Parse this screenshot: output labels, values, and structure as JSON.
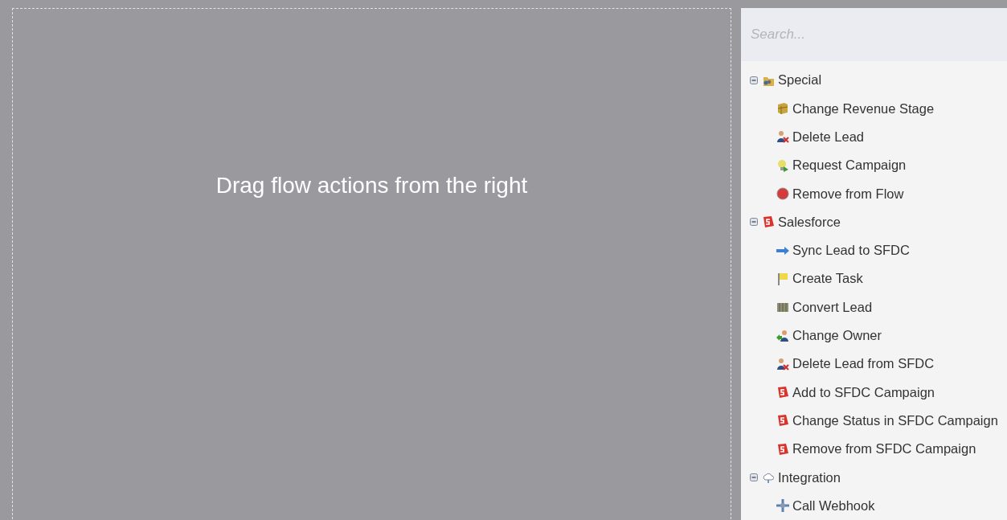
{
  "canvas": {
    "hint": "Drag flow actions from the right"
  },
  "search": {
    "placeholder": "Search..."
  },
  "tree": [
    {
      "label": "Special",
      "kind": "folder",
      "expanded": true,
      "children": [
        {
          "label": "Change Revenue Stage",
          "kind": "box"
        },
        {
          "label": "Delete Lead",
          "kind": "user-x"
        },
        {
          "label": "Request Campaign",
          "kind": "bulb"
        },
        {
          "label": "Remove from Flow",
          "kind": "stop"
        }
      ]
    },
    {
      "label": "Salesforce",
      "kind": "sfdc",
      "expanded": true,
      "children": [
        {
          "label": "Sync Lead to SFDC",
          "kind": "arrow"
        },
        {
          "label": "Create Task",
          "kind": "flag"
        },
        {
          "label": "Convert Lead",
          "kind": "convert"
        },
        {
          "label": "Change Owner",
          "kind": "user-swap"
        },
        {
          "label": "Delete Lead from SFDC",
          "kind": "user-x"
        },
        {
          "label": "Add to SFDC Campaign",
          "kind": "sfdc"
        },
        {
          "label": "Change Status in SFDC Campaign",
          "kind": "sfdc"
        },
        {
          "label": "Remove from SFDC Campaign",
          "kind": "sfdc"
        }
      ]
    },
    {
      "label": "Integration",
      "kind": "cloud",
      "expanded": true,
      "children": [
        {
          "label": "Call Webhook",
          "kind": "webhook"
        }
      ]
    }
  ]
}
